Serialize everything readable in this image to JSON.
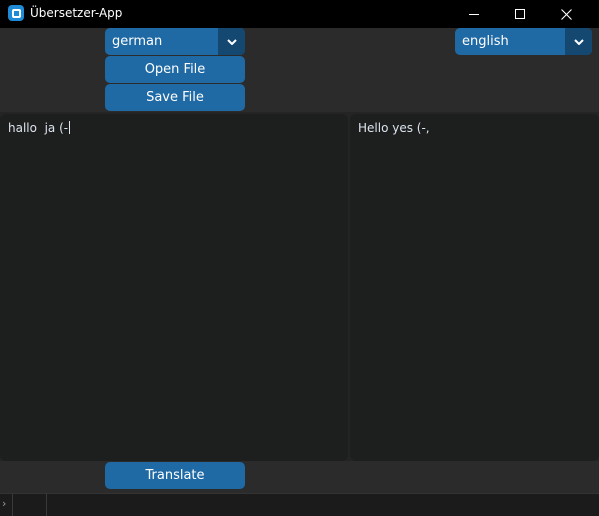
{
  "window": {
    "title": "Übersetzer-App",
    "controls": {
      "minimize": "minimize",
      "maximize": "maximize",
      "close": "✕"
    }
  },
  "source_language": {
    "selected": "german",
    "icon": "chevron-down-icon"
  },
  "target_language": {
    "selected": "english",
    "icon": "chevron-down-icon"
  },
  "buttons": {
    "open_file": "Open File",
    "save_file": "Save File",
    "translate": "Translate"
  },
  "input_text": "hallo  ja (-",
  "output_text": "Hello yes (-,",
  "statusbar": {
    "chevron": "›"
  },
  "colors": {
    "accent": "#1f6aa5",
    "accent_dark": "#144870",
    "background": "#242424",
    "textbox": "#1d1e1e",
    "titlebar": "#000000"
  }
}
